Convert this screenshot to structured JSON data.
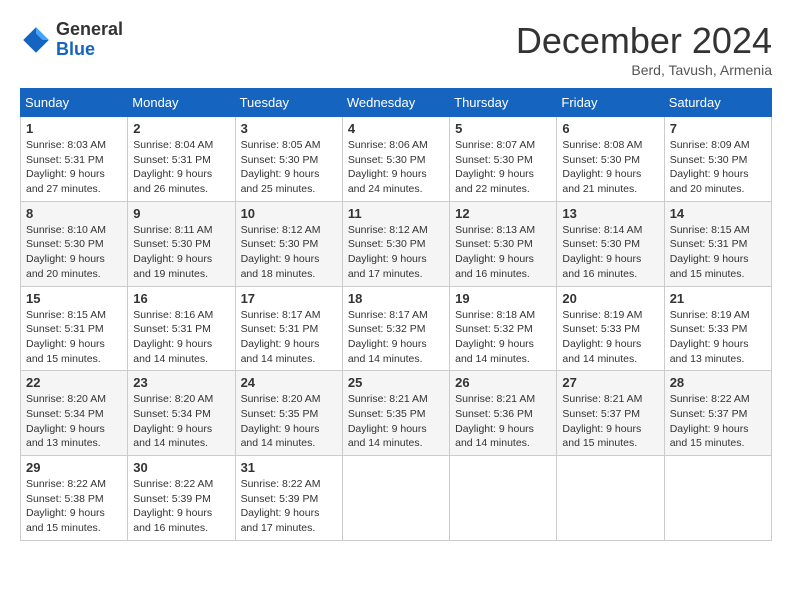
{
  "header": {
    "logo_general": "General",
    "logo_blue": "Blue",
    "month_title": "December 2024",
    "subtitle": "Berd, Tavush, Armenia"
  },
  "weekdays": [
    "Sunday",
    "Monday",
    "Tuesday",
    "Wednesday",
    "Thursday",
    "Friday",
    "Saturday"
  ],
  "weeks": [
    [
      {
        "day": "1",
        "sunrise": "8:03 AM",
        "sunset": "5:31 PM",
        "daylight": "9 hours and 27 minutes."
      },
      {
        "day": "2",
        "sunrise": "8:04 AM",
        "sunset": "5:31 PM",
        "daylight": "9 hours and 26 minutes."
      },
      {
        "day": "3",
        "sunrise": "8:05 AM",
        "sunset": "5:30 PM",
        "daylight": "9 hours and 25 minutes."
      },
      {
        "day": "4",
        "sunrise": "8:06 AM",
        "sunset": "5:30 PM",
        "daylight": "9 hours and 24 minutes."
      },
      {
        "day": "5",
        "sunrise": "8:07 AM",
        "sunset": "5:30 PM",
        "daylight": "9 hours and 22 minutes."
      },
      {
        "day": "6",
        "sunrise": "8:08 AM",
        "sunset": "5:30 PM",
        "daylight": "9 hours and 21 minutes."
      },
      {
        "day": "7",
        "sunrise": "8:09 AM",
        "sunset": "5:30 PM",
        "daylight": "9 hours and 20 minutes."
      }
    ],
    [
      {
        "day": "8",
        "sunrise": "8:10 AM",
        "sunset": "5:30 PM",
        "daylight": "9 hours and 20 minutes."
      },
      {
        "day": "9",
        "sunrise": "8:11 AM",
        "sunset": "5:30 PM",
        "daylight": "9 hours and 19 minutes."
      },
      {
        "day": "10",
        "sunrise": "8:12 AM",
        "sunset": "5:30 PM",
        "daylight": "9 hours and 18 minutes."
      },
      {
        "day": "11",
        "sunrise": "8:12 AM",
        "sunset": "5:30 PM",
        "daylight": "9 hours and 17 minutes."
      },
      {
        "day": "12",
        "sunrise": "8:13 AM",
        "sunset": "5:30 PM",
        "daylight": "9 hours and 16 minutes."
      },
      {
        "day": "13",
        "sunrise": "8:14 AM",
        "sunset": "5:30 PM",
        "daylight": "9 hours and 16 minutes."
      },
      {
        "day": "14",
        "sunrise": "8:15 AM",
        "sunset": "5:31 PM",
        "daylight": "9 hours and 15 minutes."
      }
    ],
    [
      {
        "day": "15",
        "sunrise": "8:15 AM",
        "sunset": "5:31 PM",
        "daylight": "9 hours and 15 minutes."
      },
      {
        "day": "16",
        "sunrise": "8:16 AM",
        "sunset": "5:31 PM",
        "daylight": "9 hours and 14 minutes."
      },
      {
        "day": "17",
        "sunrise": "8:17 AM",
        "sunset": "5:31 PM",
        "daylight": "9 hours and 14 minutes."
      },
      {
        "day": "18",
        "sunrise": "8:17 AM",
        "sunset": "5:32 PM",
        "daylight": "9 hours and 14 minutes."
      },
      {
        "day": "19",
        "sunrise": "8:18 AM",
        "sunset": "5:32 PM",
        "daylight": "9 hours and 14 minutes."
      },
      {
        "day": "20",
        "sunrise": "8:19 AM",
        "sunset": "5:33 PM",
        "daylight": "9 hours and 14 minutes."
      },
      {
        "day": "21",
        "sunrise": "8:19 AM",
        "sunset": "5:33 PM",
        "daylight": "9 hours and 13 minutes."
      }
    ],
    [
      {
        "day": "22",
        "sunrise": "8:20 AM",
        "sunset": "5:34 PM",
        "daylight": "9 hours and 13 minutes."
      },
      {
        "day": "23",
        "sunrise": "8:20 AM",
        "sunset": "5:34 PM",
        "daylight": "9 hours and 14 minutes."
      },
      {
        "day": "24",
        "sunrise": "8:20 AM",
        "sunset": "5:35 PM",
        "daylight": "9 hours and 14 minutes."
      },
      {
        "day": "25",
        "sunrise": "8:21 AM",
        "sunset": "5:35 PM",
        "daylight": "9 hours and 14 minutes."
      },
      {
        "day": "26",
        "sunrise": "8:21 AM",
        "sunset": "5:36 PM",
        "daylight": "9 hours and 14 minutes."
      },
      {
        "day": "27",
        "sunrise": "8:21 AM",
        "sunset": "5:37 PM",
        "daylight": "9 hours and 15 minutes."
      },
      {
        "day": "28",
        "sunrise": "8:22 AM",
        "sunset": "5:37 PM",
        "daylight": "9 hours and 15 minutes."
      }
    ],
    [
      {
        "day": "29",
        "sunrise": "8:22 AM",
        "sunset": "5:38 PM",
        "daylight": "9 hours and 15 minutes."
      },
      {
        "day": "30",
        "sunrise": "8:22 AM",
        "sunset": "5:39 PM",
        "daylight": "9 hours and 16 minutes."
      },
      {
        "day": "31",
        "sunrise": "8:22 AM",
        "sunset": "5:39 PM",
        "daylight": "9 hours and 17 minutes."
      },
      null,
      null,
      null,
      null
    ]
  ]
}
